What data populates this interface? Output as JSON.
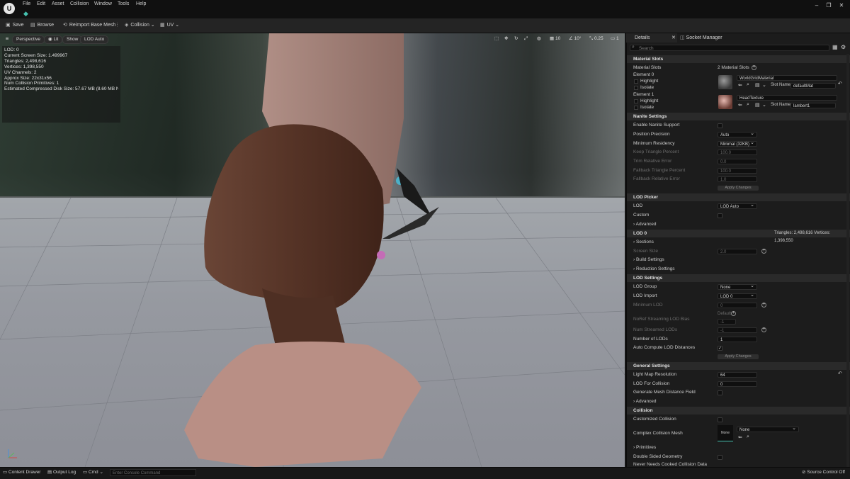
{
  "menu": [
    "File",
    "Edit",
    "Asset",
    "Collision",
    "Window",
    "Tools",
    "Help"
  ],
  "toolbar": {
    "save": "Save",
    "browse": "Browse",
    "reimport": "Reimport Base Mesh",
    "collision": "Collision",
    "uv": "UV"
  },
  "viewport": {
    "perspective": "Perspective",
    "lit": "Lit",
    "show": "Show",
    "lod": "LOD Auto",
    "stats": [
      "LOD:  0",
      "Current Screen Size:  1.499967",
      "Triangles:  2,498,616",
      "Vertices:  1,398,550",
      "UV Channels:  2",
      "Approx Size: 22x31x56",
      "Num Collision Primitives:  1",
      "Estimated Compressed Disk Size: 57.67 MB (8.60 MB Nanite)"
    ],
    "right_controls": {
      "grid": "10",
      "angle": "10°",
      "scale": "0.25",
      "camera": "1"
    }
  },
  "details": {
    "tab_details": "Details",
    "tab_socket": "Socket Manager",
    "search_placeholder": "Search",
    "material_slots": {
      "section": "Material Slots",
      "label": "Material Slots",
      "count": "2 Material Slots",
      "element0": "Element 0",
      "element1": "Element 1",
      "highlight": "Highlight",
      "isolate": "Isolate",
      "mat0": "WorldGridMaterial",
      "mat1": "HeadTexture",
      "slot_name_label": "Slot Name",
      "slot0": "defaultMat",
      "slot1": "lambert1"
    },
    "nanite": {
      "section": "Nanite Settings",
      "enable": "Enable Nanite Support",
      "position_precision": "Position Precision",
      "position_precision_val": "Auto",
      "min_residency": "Minimum Residency",
      "min_residency_val": "Minimal (32KB)",
      "keep_tri": "Keep Triangle Percent",
      "keep_tri_val": "100.0",
      "trim_err": "Trim Relative Error",
      "trim_err_val": "0.0",
      "fallback_tri": "Fallback Triangle Percent",
      "fallback_tri_val": "100.0",
      "fallback_err": "Fallback Relative Error",
      "fallback_err_val": "1.0",
      "apply": "Apply Changes"
    },
    "lod_picker": {
      "section": "LOD Picker",
      "lod": "LOD",
      "lod_val": "LOD Auto",
      "custom": "Custom",
      "advanced": "Advanced"
    },
    "lod0": {
      "section": "LOD 0",
      "stats": "Triangles: 2,498,616   Vertices: 1,398,550",
      "sections": "Sections",
      "screen_size": "Screen Size",
      "screen_size_val": "2.0",
      "build": "Build Settings",
      "reduction": "Reduction Settings"
    },
    "lod_settings": {
      "section": "LOD Settings",
      "group": "LOD Group",
      "group_val": "None",
      "import": "LOD Import",
      "import_val": "LOD 0",
      "min_lod": "Minimum LOD",
      "min_lod_val": "0",
      "default": "Default",
      "noref": "NoRef Streaming LOD Bias",
      "noref_val": "-1",
      "num_streamed": "Num Streamed LODs",
      "num_streamed_val": "-1",
      "num_lods": "Number of LODs",
      "num_lods_val": "1",
      "auto_compute": "Auto Compute LOD Distances",
      "apply": "Apply Changes"
    },
    "general": {
      "section": "General Settings",
      "lightmap": "Light Map Resolution",
      "lightmap_val": "64",
      "lod_collision": "LOD For Collision",
      "lod_collision_val": "0",
      "gen_distance": "Generate Mesh Distance Field",
      "advanced": "Advanced"
    },
    "collision": {
      "section": "Collision",
      "customized": "Customized Collision",
      "complex_mesh": "Complex Collision Mesh",
      "complex_thumb": "None",
      "complex_val": "None",
      "primitives": "Primitives",
      "double_sided": "Double Sided Geometry",
      "never_needs": "Never Needs Cooked Collision Data"
    }
  },
  "statusbar": {
    "content_drawer": "Content Drawer",
    "output_log": "Output Log",
    "cmd": "Cmd",
    "console_placeholder": "Enter Console Command",
    "source_control": "Source Control Off"
  },
  "colors": {
    "accent": "#46c2b0",
    "panel": "#1c1c1c",
    "section": "#2a2a2a",
    "checkbox_blue": "#4a8fd6"
  }
}
